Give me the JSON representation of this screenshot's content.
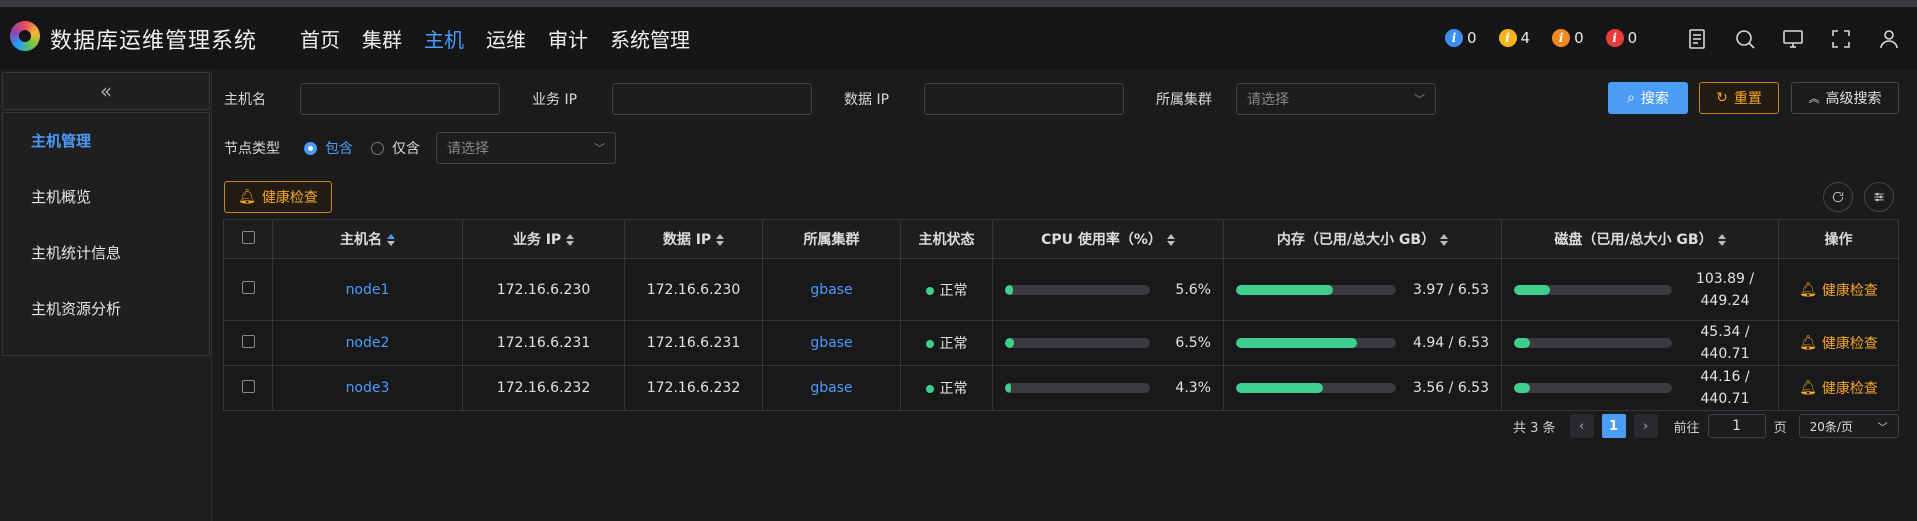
{
  "app": {
    "title": "数据库运维管理系统"
  },
  "nav": [
    "首页",
    "集群",
    "主机",
    "运维",
    "审计",
    "系统管理"
  ],
  "nav_active": 2,
  "alerts": [
    {
      "count": "0",
      "color": "#3b8ff0"
    },
    {
      "count": "4",
      "color": "#f5b320"
    },
    {
      "count": "0",
      "color": "#f28a1e"
    },
    {
      "count": "0",
      "color": "#e83b3b"
    }
  ],
  "toolbar_icons": [
    "document-icon",
    "search-icon",
    "monitor-icon",
    "fullscreen-icon",
    "user-icon"
  ],
  "sidebar": {
    "items": [
      "主机管理",
      "主机概览",
      "主机统计信息",
      "主机资源分析"
    ]
  },
  "filters": {
    "host_label": "主机名",
    "biz_ip_label": "业务 IP",
    "data_ip_label": "数据 IP",
    "cluster_label": "所属集群",
    "cluster_placeholder": "请选择",
    "node_type_label": "节点类型",
    "radio_include": "包含",
    "radio_only": "仅含",
    "node_type_placeholder": "请选择",
    "search_btn": "搜索",
    "reset_btn": "重置",
    "advanced_btn": "高级搜索",
    "health_btn": "健康检查"
  },
  "table": {
    "headers": [
      "主机名",
      "业务 IP",
      "数据 IP",
      "所属集群",
      "主机状态",
      "CPU 使用率（%）",
      "内存（已用/总大小 GB）",
      "磁盘（已用/总大小 GB）",
      "操作"
    ],
    "rows": [
      {
        "host": "node1",
        "biz_ip": "172.16.6.230",
        "data_ip": "172.16.6.230",
        "cluster": "gbase",
        "status": "正常",
        "cpu": "5.6%",
        "cpu_pct": 5.6,
        "mem": "3.97 / 6.53",
        "mem_pct": 60.8,
        "disk": "103.89 / 449.24",
        "disk_pct": 23.1,
        "op": "健康检查"
      },
      {
        "host": "node2",
        "biz_ip": "172.16.6.231",
        "data_ip": "172.16.6.231",
        "cluster": "gbase",
        "status": "正常",
        "cpu": "6.5%",
        "cpu_pct": 6.5,
        "mem": "4.94 / 6.53",
        "mem_pct": 75.7,
        "disk": "45.34 / 440.71",
        "disk_pct": 10.3,
        "op": "健康检查"
      },
      {
        "host": "node3",
        "biz_ip": "172.16.6.232",
        "data_ip": "172.16.6.232",
        "cluster": "gbase",
        "status": "正常",
        "cpu": "4.3%",
        "cpu_pct": 4.3,
        "mem": "3.56 / 6.53",
        "mem_pct": 54.5,
        "disk": "44.16 / 440.71",
        "disk_pct": 10.0,
        "op": "健康检查"
      }
    ]
  },
  "pagination": {
    "total": "共 3 条",
    "current": "1",
    "goto_label": "前往",
    "goto_value": "1",
    "page_unit": "页",
    "page_size": "20条/页"
  },
  "colors": {
    "accent": "#4a9cf7",
    "warn": "#f5a623",
    "ok": "#3ecf8e"
  }
}
